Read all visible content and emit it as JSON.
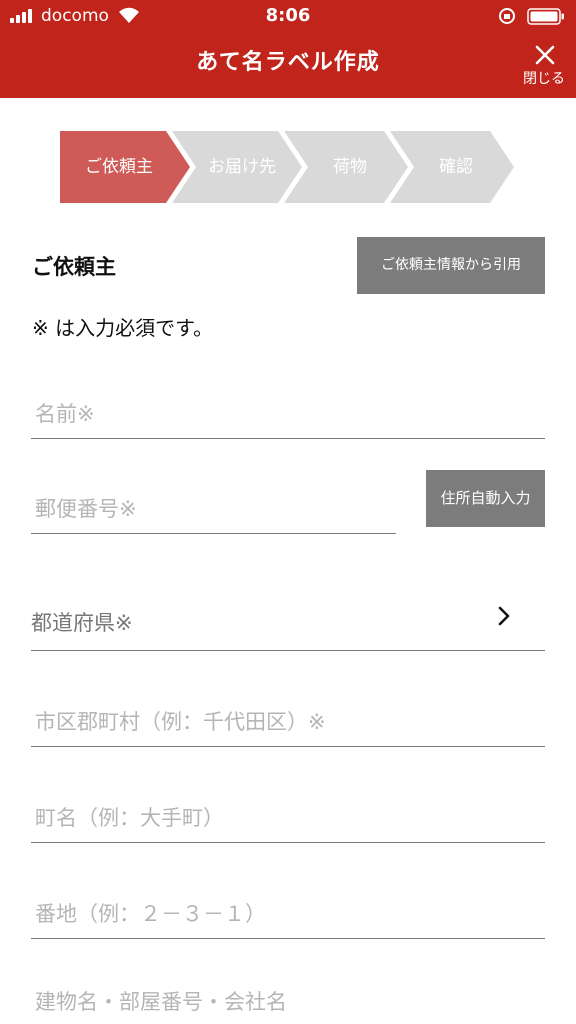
{
  "status_bar": {
    "carrier": "docomo",
    "time": "8:06"
  },
  "header": {
    "title": "あて名ラベル作成",
    "close_label": "閉じる",
    "background_color": "#c0241b"
  },
  "steps": [
    {
      "label": "ご依頼主",
      "active": true
    },
    {
      "label": "お届け先",
      "active": false
    },
    {
      "label": "荷物",
      "active": false
    },
    {
      "label": "確認",
      "active": false
    }
  ],
  "step_colors": {
    "active": "#cf5b59",
    "inactive": "#d9d9d9"
  },
  "section": {
    "title": "ご依頼主",
    "quote_button": "ご依頼主情報から引用",
    "required_note": "※ は入力必須です。"
  },
  "form": {
    "name_placeholder": "名前※",
    "postal_placeholder": "郵便番号※",
    "address_auto_button": "住所自動入力",
    "prefecture_label": "都道府県※",
    "city_placeholder": "市区郡町村（例：千代田区）※",
    "town_placeholder": "町名（例：大手町）",
    "block_placeholder": "番地（例：２－３－１）",
    "building_placeholder": "建物名・部屋番号・会社名"
  },
  "icons": {
    "signal": "signal-icon",
    "wifi": "wifi-icon",
    "rotation_lock": "rotation-lock-icon",
    "battery": "battery-icon",
    "close": "close-icon",
    "chevron": "chevron-right-icon"
  }
}
